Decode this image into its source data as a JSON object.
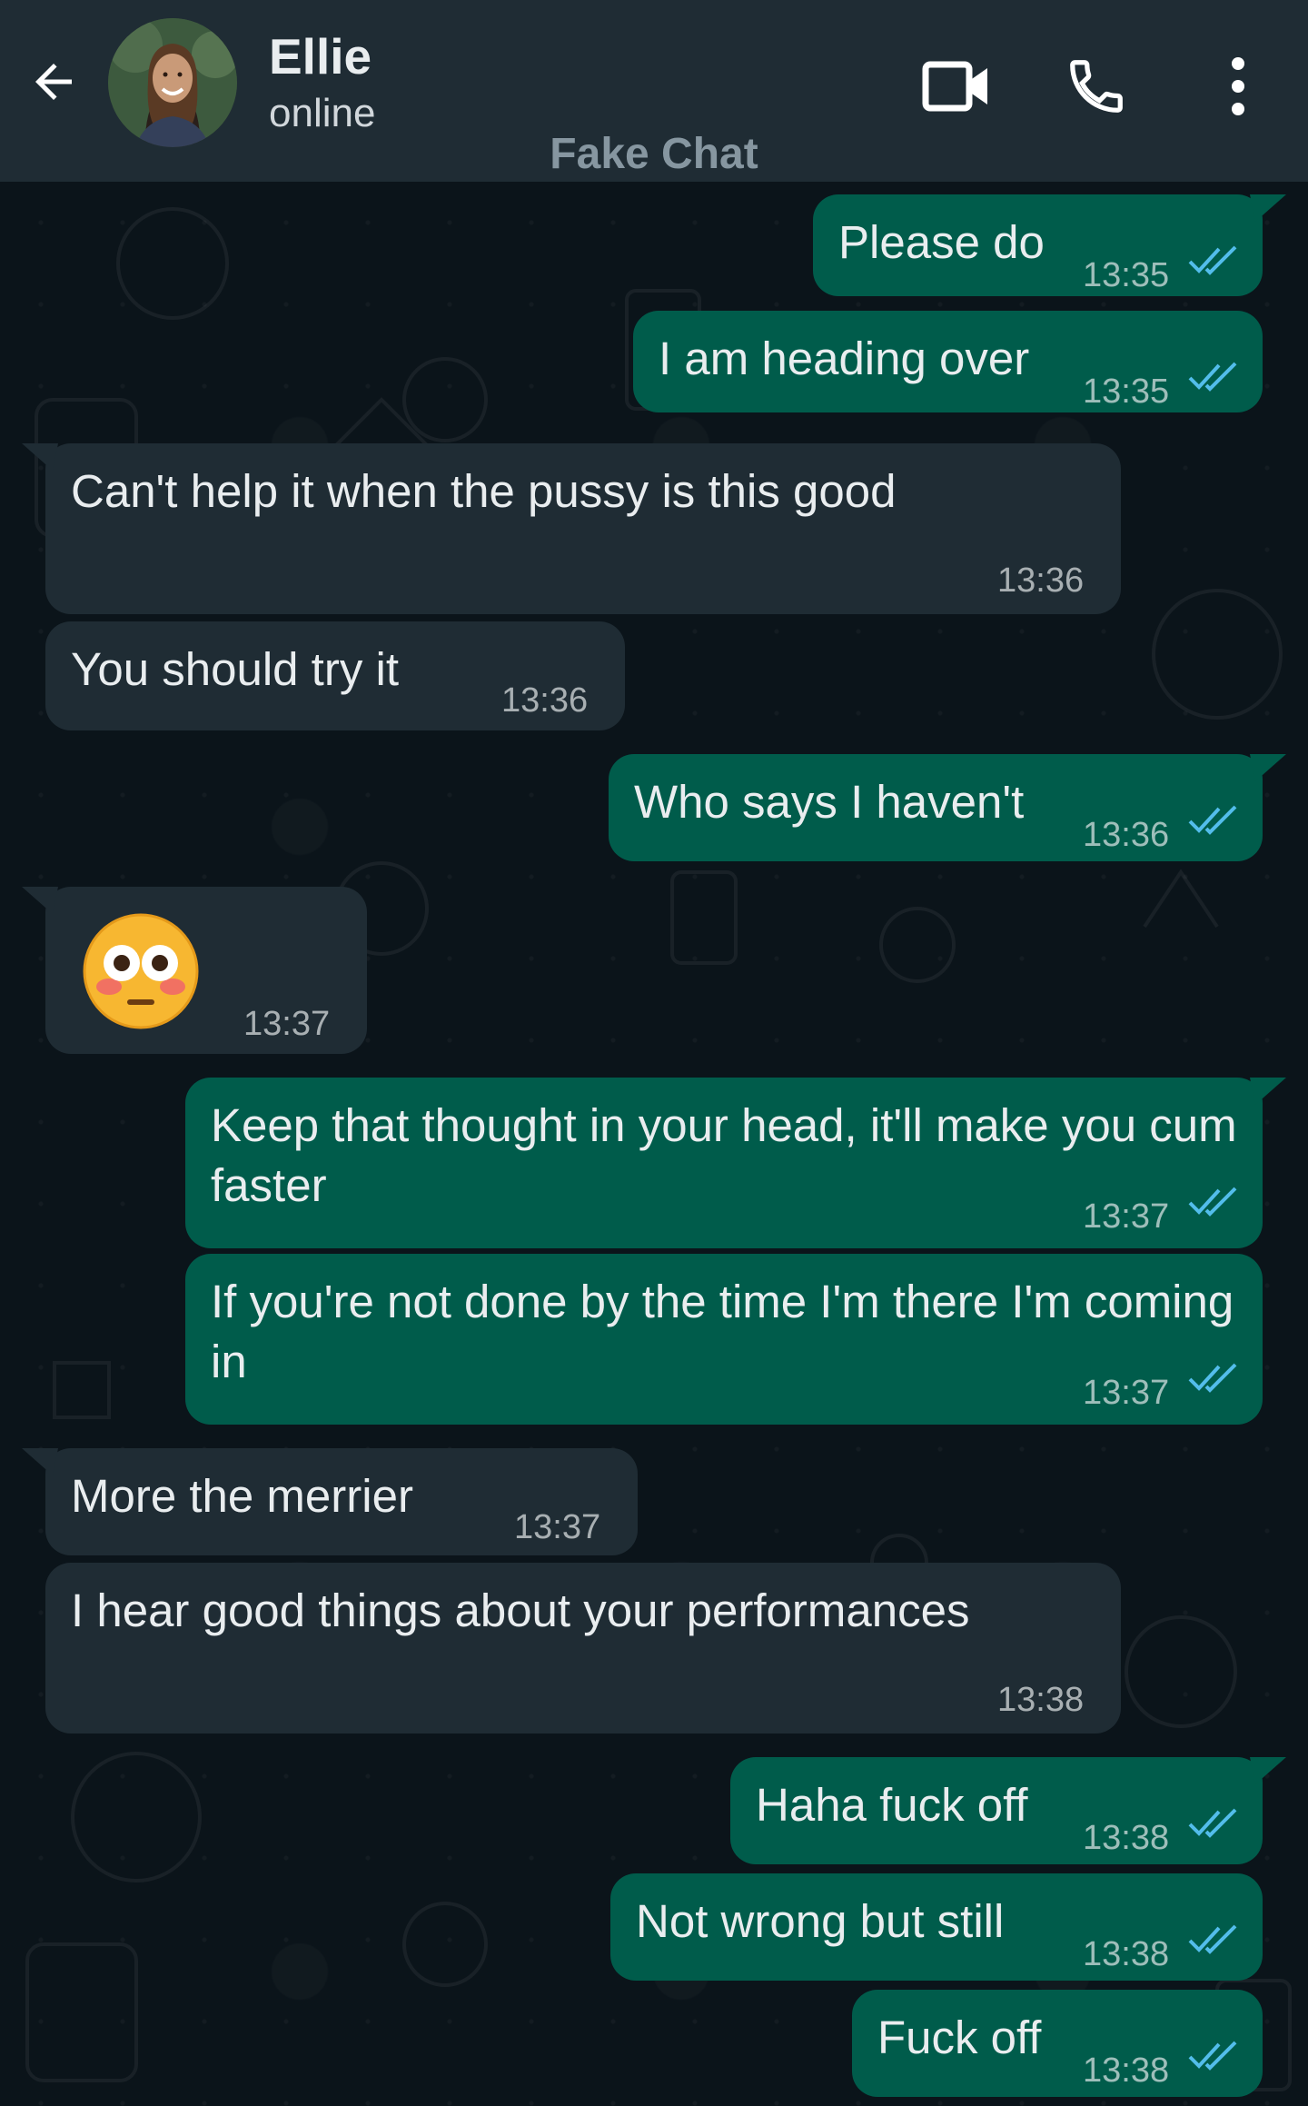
{
  "header": {
    "contact_name": "Ellie",
    "status": "online",
    "watermark": "Fake Chat"
  },
  "colors": {
    "header_bg": "#1f2c34",
    "chat_bg": "#0b141a",
    "outgoing_bubble": "#005c4b",
    "incoming_bubble": "#1f2c34",
    "read_tick": "#53bdeb"
  },
  "icons": {
    "back": "arrow-left-icon",
    "video": "video-camera-icon",
    "call": "phone-icon",
    "menu": "more-vertical-icon",
    "read": "double-check-icon"
  },
  "messages": [
    {
      "dir": "out",
      "text": "Please do",
      "time": "13:35",
      "read": true
    },
    {
      "dir": "out",
      "text": "I am heading over",
      "time": "13:35",
      "read": true
    },
    {
      "dir": "in",
      "text": "Can't help it when the pussy is this good",
      "time": "13:36"
    },
    {
      "dir": "in",
      "text": "You should try it",
      "time": "13:36"
    },
    {
      "dir": "out",
      "text": "Who says I haven't",
      "time": "13:36",
      "read": true
    },
    {
      "dir": "in",
      "text": "",
      "emoji": "flushed-face-emoji",
      "time": "13:37"
    },
    {
      "dir": "out",
      "text": "Keep that thought in your head, it'll make you cum faster",
      "time": "13:37",
      "read": true
    },
    {
      "dir": "out",
      "text": "If you're not done by the time I'm there I'm coming in",
      "time": "13:37",
      "read": true
    },
    {
      "dir": "in",
      "text": "More the merrier",
      "time": "13:37"
    },
    {
      "dir": "in",
      "text": "I hear good things about your performances",
      "time": "13:38"
    },
    {
      "dir": "out",
      "text": "Haha fuck off",
      "time": "13:38",
      "read": true
    },
    {
      "dir": "out",
      "text": "Not wrong but still",
      "time": "13:38",
      "read": true
    },
    {
      "dir": "out",
      "text": "Fuck off",
      "time": "13:38",
      "read": true
    }
  ]
}
